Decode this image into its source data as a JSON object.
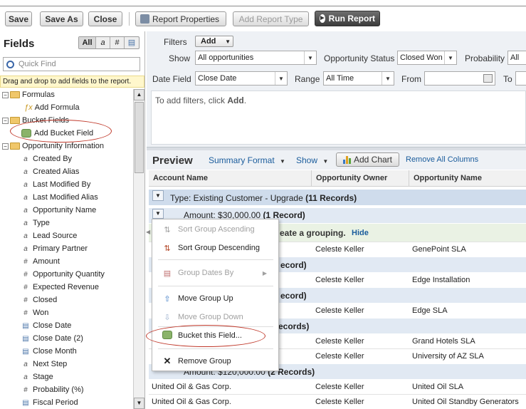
{
  "toolbar": {
    "save": "Save",
    "save_as": "Save As",
    "close": "Close",
    "report_properties": "Report Properties",
    "add_report_type": "Add Report Type",
    "run_report": "Run Report"
  },
  "fields_panel": {
    "title": "Fields",
    "filter_all": "All",
    "filter_text": "a",
    "filter_num": "#",
    "filter_date": "▤",
    "search_placeholder": "Quick Find",
    "hint": "Drag and drop to add fields to the report.",
    "tree": {
      "formulas": "Formulas",
      "add_formula": "Add Formula",
      "bucket_fields": "Bucket Fields",
      "add_bucket_field": "Add Bucket Field",
      "opportunity_information": "Opportunity Information",
      "fields": [
        {
          "icon": "a",
          "label": "Created By"
        },
        {
          "icon": "a",
          "label": "Created Alias"
        },
        {
          "icon": "a",
          "label": "Last Modified By"
        },
        {
          "icon": "a",
          "label": "Last Modified Alias"
        },
        {
          "icon": "a",
          "label": "Opportunity Name"
        },
        {
          "icon": "a",
          "label": "Type"
        },
        {
          "icon": "a",
          "label": "Lead Source"
        },
        {
          "icon": "a",
          "label": "Primary Partner"
        },
        {
          "icon": "#",
          "label": "Amount"
        },
        {
          "icon": "#",
          "label": "Opportunity Quantity"
        },
        {
          "icon": "#",
          "label": "Expected Revenue"
        },
        {
          "icon": "#",
          "label": "Closed"
        },
        {
          "icon": "#",
          "label": "Won"
        },
        {
          "icon": "▤",
          "label": "Close Date"
        },
        {
          "icon": "▤",
          "label": "Close Date (2)"
        },
        {
          "icon": "▤",
          "label": "Close Month"
        },
        {
          "icon": "a",
          "label": "Next Step"
        },
        {
          "icon": "a",
          "label": "Stage"
        },
        {
          "icon": "#",
          "label": "Probability (%)"
        },
        {
          "icon": "▤",
          "label": "Fiscal Period"
        }
      ]
    }
  },
  "filters": {
    "label": "Filters",
    "add": "Add",
    "show_label": "Show",
    "show_value": "All opportunities",
    "opp_status_label": "Opportunity Status",
    "opp_status_value": "Closed Won",
    "probability_label": "Probability",
    "probability_value": "All",
    "date_field_label": "Date Field",
    "date_field_value": "Close Date",
    "range_label": "Range",
    "range_value": "All Time",
    "from_label": "From",
    "to_label": "To",
    "hint_prefix": "To add filters, click ",
    "hint_bold": "Add",
    "hint_suffix": "."
  },
  "preview": {
    "title": "Preview",
    "format": "Summary Format",
    "show": "Show",
    "add_chart": "Add Chart",
    "remove_all": "Remove All Columns",
    "columns": [
      "Account Name",
      "Opportunity Owner",
      "Opportunity Name"
    ],
    "group1": "Type: Existing Customer - Upgrade",
    "group1_count": "(11 Records)",
    "group2": "Amount: $30,000.00",
    "group2_count": "(1 Record)",
    "grouping_hint": "eate a grouping.",
    "hide": "Hide",
    "rec_fragment": "ecord)",
    "rec_fragment2": "ecords)",
    "last_group": "Amount: $120,000.00",
    "last_group_count": "(2 Records)",
    "rows": [
      {
        "account": "",
        "owner": "Celeste Keller",
        "opp": "GenePoint SLA"
      },
      {
        "account": "",
        "owner": "Celeste Keller",
        "opp": "Edge Installation"
      },
      {
        "account": "",
        "owner": "Celeste Keller",
        "opp": "Edge SLA"
      },
      {
        "account": "",
        "owner": "Celeste Keller",
        "opp": "Grand Hotels SLA"
      },
      {
        "account": "",
        "owner": "Celeste Keller",
        "opp": "University of AZ SLA"
      },
      {
        "account": "United Oil & Gas Corp.",
        "owner": "Celeste Keller",
        "opp": "United Oil SLA"
      },
      {
        "account": "United Oil & Gas Corp.",
        "owner": "Celeste Keller",
        "opp": "United Oil Standby Generators"
      }
    ]
  },
  "context_menu": {
    "sort_asc": "Sort Group Ascending",
    "sort_desc": "Sort Group Descending",
    "group_dates_by": "Group Dates By",
    "move_up": "Move Group Up",
    "move_down": "Move Group Down",
    "bucket": "Bucket this Field...",
    "remove": "Remove Group"
  },
  "colors": {
    "highlight_ellipse": "#c0392b",
    "group_row": "#cfdcec",
    "link": "#1a5c9c"
  }
}
